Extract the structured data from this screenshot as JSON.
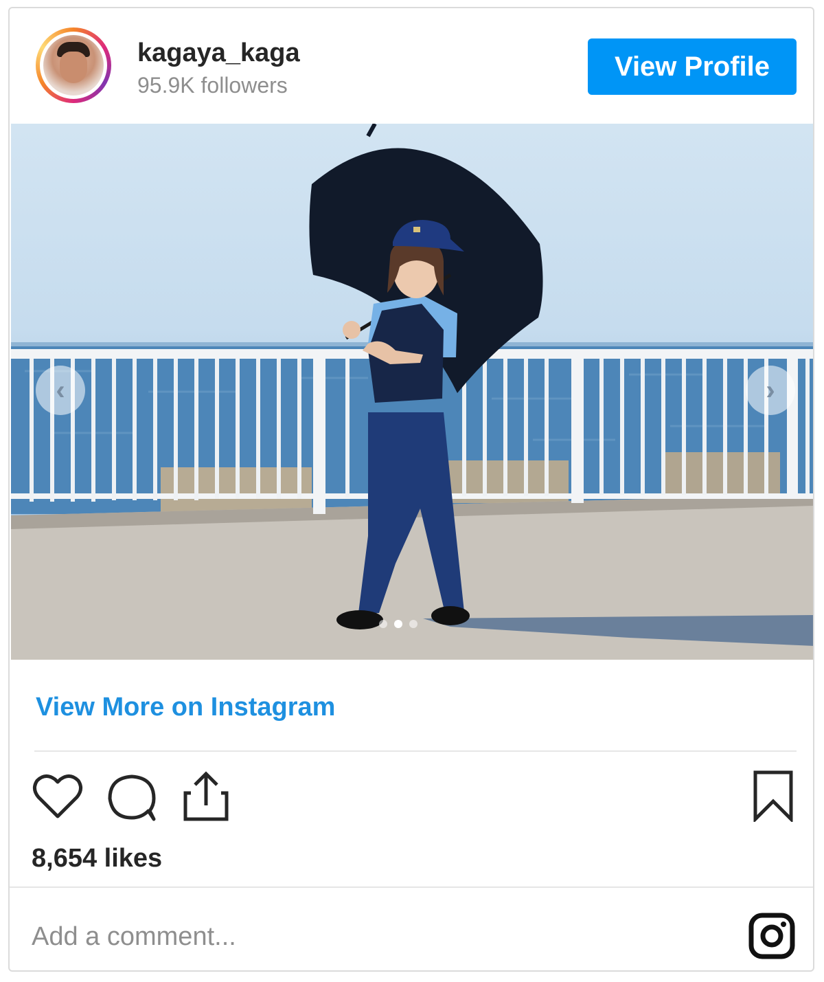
{
  "header": {
    "username": "kagaya_kaga",
    "followers": "95.9K followers",
    "view_profile_label": "View Profile"
  },
  "carousel": {
    "prev_glyph": "‹",
    "next_glyph": "›",
    "slide_count": 3,
    "active_slide": 2
  },
  "post": {
    "view_more_label": "View More on Instagram",
    "likes": "8,654 likes",
    "comment_placeholder": "Add a comment..."
  },
  "icons": {
    "like": "heart-icon",
    "comment": "comment-icon",
    "share": "share-icon",
    "save": "bookmark-icon",
    "brand": "instagram-icon"
  },
  "colors": {
    "accent": "#0095f6",
    "link": "#1e90e0",
    "text": "#262626",
    "muted": "#8e8e8e"
  }
}
